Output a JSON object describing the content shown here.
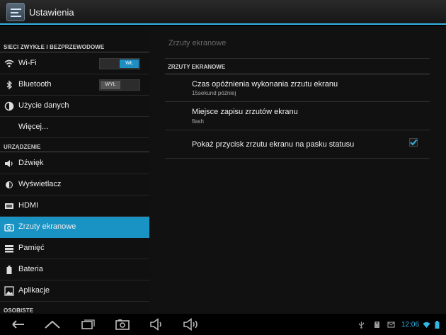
{
  "app": {
    "title": "Ustawienia",
    "icon": "settings-sliders-icon"
  },
  "sidebar": {
    "section_wireless": "SIECI ZWYKŁE I BEZPRZEWODOWE",
    "section_device": "URZĄDZENIE",
    "section_personal": "OSOBISTE",
    "items": [
      {
        "label": "Wi-Fi",
        "icon": "wifi-icon",
        "toggle": "WŁ",
        "toggle_state": "on"
      },
      {
        "label": "Bluetooth",
        "icon": "bluetooth-icon",
        "toggle": "WYŁ",
        "toggle_state": "off"
      },
      {
        "label": "Użycie danych",
        "icon": "data-usage-icon"
      },
      {
        "label": "Więcej...",
        "icon": ""
      },
      {
        "label": "Dźwięk",
        "icon": "speaker-icon"
      },
      {
        "label": "Wyświetlacz",
        "icon": "brightness-icon"
      },
      {
        "label": "HDMI",
        "icon": "hdmi-icon"
      },
      {
        "label": "Zrzuty ekranowe",
        "icon": "camera-icon",
        "selected": true
      },
      {
        "label": "Pamięć",
        "icon": "storage-icon"
      },
      {
        "label": "Bateria",
        "icon": "battery-icon"
      },
      {
        "label": "Aplikacje",
        "icon": "apps-icon"
      }
    ]
  },
  "main": {
    "breadcrumb": "Zrzuty ekranowe",
    "section": "ZRZUTY EKRANOWE",
    "prefs": [
      {
        "title": "Czas opóźnienia wykonania zrzutu ekranu",
        "summary": "15sekund później"
      },
      {
        "title": "Miejsce zapisu zrzutów ekranu",
        "summary": "flash"
      },
      {
        "title": "Pokaż przycisk zrzutu ekranu na pasku statusu",
        "checked": true
      }
    ]
  },
  "navbar": {
    "buttons": [
      "back-icon",
      "home-icon",
      "recent-apps-icon",
      "screenshot-icon",
      "volume-down-icon",
      "volume-up-icon"
    ],
    "status_icons": [
      "usb-icon",
      "sd-card-icon",
      "notification-icon",
      "wifi-signal-icon",
      "battery-status-icon"
    ],
    "time": "12:06"
  },
  "colors": {
    "accent": "#33b5e5",
    "selected": "#1993c4"
  }
}
